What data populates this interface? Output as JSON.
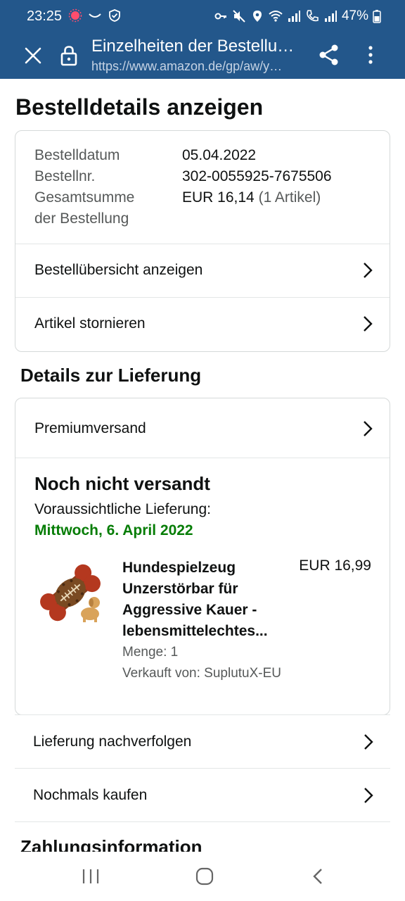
{
  "status_bar": {
    "time": "23:25",
    "battery": "47%",
    "icons": [
      "notification-dot-icon",
      "smile-icon",
      "shield-icon",
      "key-icon",
      "mute-icon",
      "location-icon",
      "wifi-icon",
      "signal-icon",
      "call-icon",
      "signal-icon-2",
      "battery-icon"
    ]
  },
  "browser": {
    "title": "Einzelheiten der Bestellu…",
    "url": "https://www.amazon.de/gp/aw/y…"
  },
  "page": {
    "heading": "Bestelldetails anzeigen",
    "order": {
      "date_label": "Bestelldatum",
      "date": "05.04.2022",
      "number_label": "Bestellnr.",
      "number": "302-0055925-7675506",
      "total_label_1": "Gesamtsumme",
      "total_label_2": "der Bestellung",
      "total": "EUR 16,14",
      "total_count": "(1 Artikel)"
    },
    "links": {
      "overview": "Bestellübersicht anzeigen",
      "cancel": "Artikel stornieren"
    },
    "delivery": {
      "heading": "Details zur Lieferung",
      "shipping_method": "Premiumversand",
      "status": "Noch nicht versandt",
      "eta_label": "Voraussichtliche Lieferung:",
      "eta_date": "Mittwoch, 6. April 2022",
      "product": {
        "title": "Hundespielzeug Unzerstörbar für Aggressive Kauer - lebensmittelechtes...",
        "price": "EUR 16,99",
        "quantity": "Menge: 1",
        "seller": "Verkauft von: SuplutuX-EU"
      }
    },
    "actions": {
      "track": "Lieferung nachverfolgen",
      "buy_again": "Nochmals kaufen"
    },
    "payment_heading": "Zahlungsinformation"
  },
  "colors": {
    "toolbar": "#23578b",
    "delivery_green": "#067d06",
    "border": "#d5d9d9"
  }
}
